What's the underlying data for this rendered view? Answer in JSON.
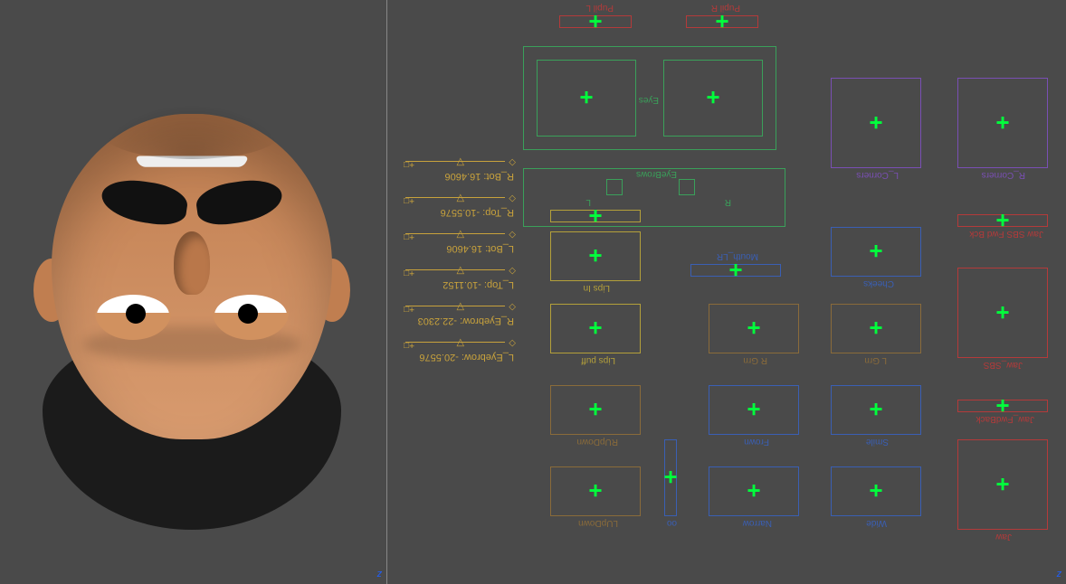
{
  "axis_left": "z",
  "axis_right": "z",
  "controls": {
    "jaw": "Jaw",
    "jaw_fwdback": "Jaw_FwdBack",
    "jaw_sbs": "Jaw_SBS",
    "jaw_sbs_fwdbck": "Jaw SBS Fwd Bck",
    "wide": "Wide",
    "narrow": "Narrow",
    "smile": "Smile",
    "frown": "Frown",
    "l_grn": "L Grn",
    "r_grn": "R Grn",
    "cheeks": "Cheeks",
    "mouth_lr": "Mouth_LR",
    "oo": "oo",
    "lupdown": "LUpDown",
    "rupdown": "RUpDown",
    "lips_puff": "Lips puff",
    "lips_in": "Lips In",
    "l_corners": "L_Corners",
    "r_corners": "R_Corners",
    "eyebrows": "EyeBrows",
    "eyebrow_l": "L",
    "eyebrow_r": "R",
    "eyes": "Eyes",
    "pupil_l": "Pupil L",
    "pupil_r": "Pupil R"
  },
  "attributes": [
    {
      "name": "L_Eyebrow:",
      "value": "-20.5576"
    },
    {
      "name": "R_Eyebrow:",
      "value": "-22.2303"
    },
    {
      "name": "L_Top:",
      "value": "-10.1152"
    },
    {
      "name": "L_Bot:",
      "value": "16.4606"
    },
    {
      "name": "R_Top:",
      "value": "-10.5576"
    },
    {
      "name": "R_Bot:",
      "value": "16.4606"
    }
  ],
  "slider_icons": {
    "key": "◇",
    "thumb": "▽",
    "zero": "+□"
  }
}
